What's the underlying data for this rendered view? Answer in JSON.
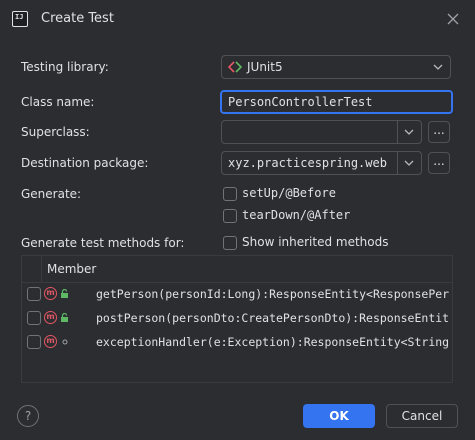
{
  "window": {
    "title": "Create Test",
    "app_icon_text": "IJ"
  },
  "form": {
    "testing_library_label": "Testing library:",
    "testing_library_value": "JUnit5",
    "class_name_label": "Class name:",
    "class_name_value": "PersonControllerTest",
    "superclass_label": "Superclass:",
    "superclass_value": "",
    "destination_label": "Destination package:",
    "destination_value": "xyz.practicespring.web",
    "browse_label": "...",
    "generate_label": "Generate:",
    "setup_label": "setUp/@Before",
    "teardown_label": "tearDown/@After",
    "methods_label": "Generate test methods for:",
    "show_inherited_label": "Show inherited methods"
  },
  "table": {
    "header": "Member",
    "rows": [
      {
        "icon": "method-icon",
        "visibility": "public-lock-icon",
        "text": "getPerson(personId:Long):ResponseEntity<ResponsePer"
      },
      {
        "icon": "method-icon",
        "visibility": "public-lock-icon",
        "text": "postPerson(personDto:CreatePersonDto):ResponseEntit"
      },
      {
        "icon": "method-icon",
        "visibility": "package-dot-icon",
        "text": "exceptionHandler(e:Exception):ResponseEntity<String"
      }
    ]
  },
  "buttons": {
    "ok": "OK",
    "cancel": "Cancel",
    "help": "?"
  },
  "colors": {
    "accent": "#3574f0",
    "background": "#2b2d30",
    "method_icon": "#e55765",
    "lock_icon": "#5fb865",
    "junit_red": "#e55765",
    "junit_green": "#5fb865"
  }
}
